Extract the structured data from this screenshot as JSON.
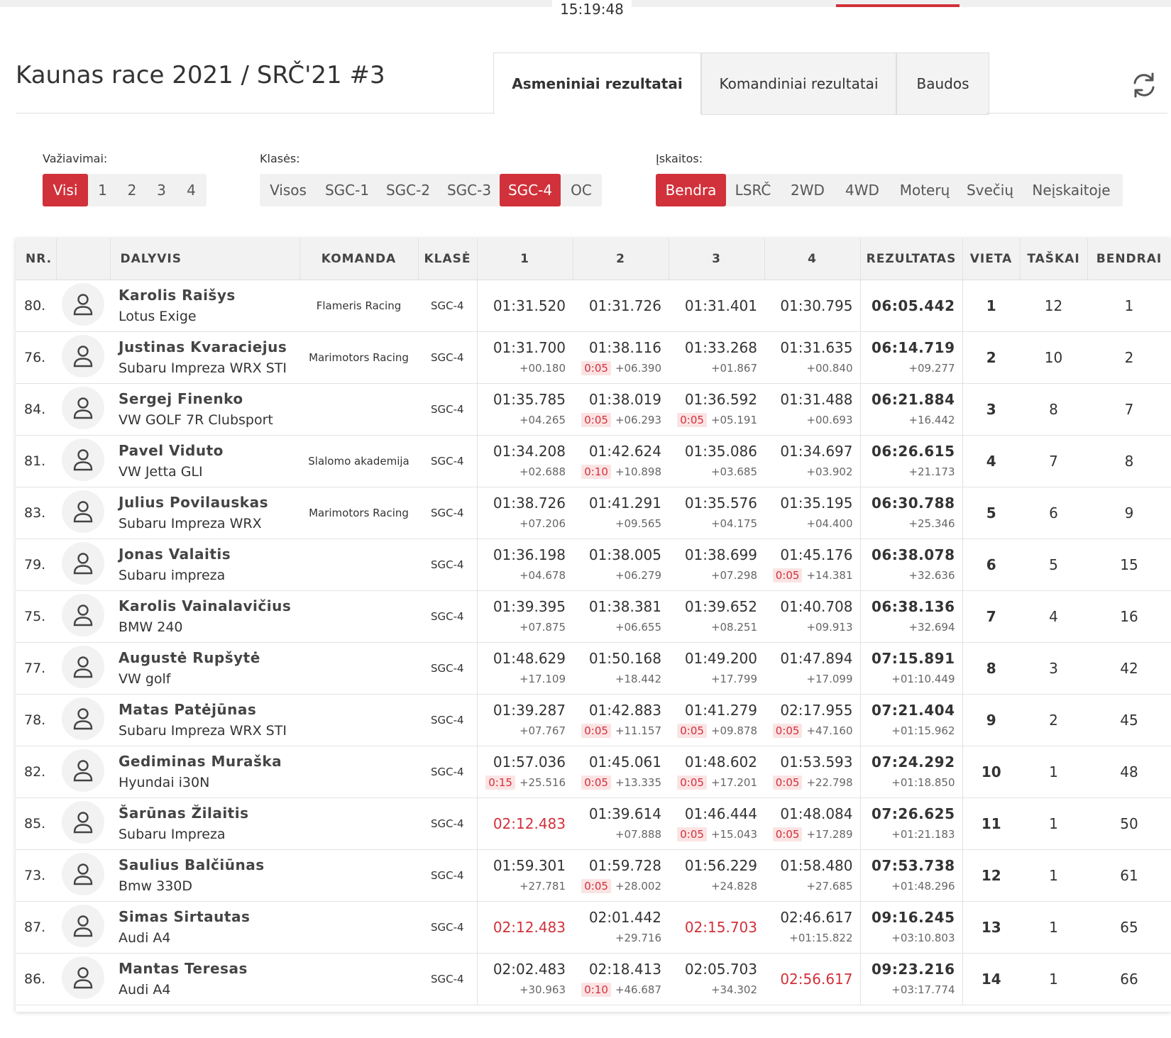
{
  "header": {
    "clock": "15:19:48",
    "title": "Kaunas race 2021 / SRČ'21 #3",
    "tabs": [
      {
        "label": "Asmeniniai rezultatai",
        "active": true
      },
      {
        "label": "Komandiniai rezultatai",
        "active": false
      },
      {
        "label": "Baudos",
        "active": false
      }
    ],
    "refresh_icon": "refresh-icon",
    "accent_color": "#d1313a"
  },
  "filters": {
    "runs": {
      "label": "Važiavimai:",
      "options": [
        "Visi",
        "1",
        "2",
        "3",
        "4"
      ],
      "active": "Visi"
    },
    "classes": {
      "label": "Klasės:",
      "options": [
        "Visos",
        "SGC-1",
        "SGC-2",
        "SGC-3",
        "SGC-4",
        "OC"
      ],
      "active": "SGC-4"
    },
    "standings": {
      "label": "Įskaitos:",
      "options": [
        "Bendra",
        "LSRČ",
        "2WD",
        "4WD",
        "Moterų",
        "Svečių",
        "Neįskaitoje"
      ],
      "active": "Bendra"
    }
  },
  "table": {
    "headers": {
      "nr": "NR.",
      "driver": "DALYVIS",
      "team": "KOMANDA",
      "klase": "KLASĖ",
      "r1": "1",
      "r2": "2",
      "r3": "3",
      "r4": "4",
      "result": "REZULTATAS",
      "vieta": "VIETA",
      "taskai": "TAŠKAI",
      "bendrai": "BENDRAI"
    },
    "rows": [
      {
        "nr": "80.",
        "name": "Karolis Raišys",
        "car": "Lotus Exige",
        "team": "Flameris Racing",
        "klase": "SGC-4",
        "runs": [
          {
            "t": "01:31.520",
            "d": "",
            "p": "",
            "red": false
          },
          {
            "t": "01:31.726",
            "d": "",
            "p": "",
            "red": false
          },
          {
            "t": "01:31.401",
            "d": "",
            "p": "",
            "red": false
          },
          {
            "t": "01:30.795",
            "d": "",
            "p": "",
            "red": false
          }
        ],
        "result": "06:05.442",
        "result_diff": "",
        "vieta": "1",
        "taskai": "12",
        "bendrai": "1"
      },
      {
        "nr": "76.",
        "name": "Justinas Kvaraciejus",
        "car": "Subaru Impreza WRX STI",
        "team": "Marimotors Racing",
        "klase": "SGC-4",
        "runs": [
          {
            "t": "01:31.700",
            "d": "+00.180",
            "p": "",
            "red": false
          },
          {
            "t": "01:38.116",
            "d": "+06.390",
            "p": "0:05",
            "red": false
          },
          {
            "t": "01:33.268",
            "d": "+01.867",
            "p": "",
            "red": false
          },
          {
            "t": "01:31.635",
            "d": "+00.840",
            "p": "",
            "red": false
          }
        ],
        "result": "06:14.719",
        "result_diff": "+09.277",
        "vieta": "2",
        "taskai": "10",
        "bendrai": "2"
      },
      {
        "nr": "84.",
        "name": "Sergej Finenko",
        "car": "VW GOLF 7R Clubsport",
        "team": "",
        "klase": "SGC-4",
        "runs": [
          {
            "t": "01:35.785",
            "d": "+04.265",
            "p": "",
            "red": false
          },
          {
            "t": "01:38.019",
            "d": "+06.293",
            "p": "0:05",
            "red": false
          },
          {
            "t": "01:36.592",
            "d": "+05.191",
            "p": "0:05",
            "red": false
          },
          {
            "t": "01:31.488",
            "d": "+00.693",
            "p": "",
            "red": false
          }
        ],
        "result": "06:21.884",
        "result_diff": "+16.442",
        "vieta": "3",
        "taskai": "8",
        "bendrai": "7"
      },
      {
        "nr": "81.",
        "name": "Pavel Viduto",
        "car": "VW Jetta GLI",
        "team": "Slalomo akademija",
        "klase": "SGC-4",
        "runs": [
          {
            "t": "01:34.208",
            "d": "+02.688",
            "p": "",
            "red": false
          },
          {
            "t": "01:42.624",
            "d": "+10.898",
            "p": "0:10",
            "red": false
          },
          {
            "t": "01:35.086",
            "d": "+03.685",
            "p": "",
            "red": false
          },
          {
            "t": "01:34.697",
            "d": "+03.902",
            "p": "",
            "red": false
          }
        ],
        "result": "06:26.615",
        "result_diff": "+21.173",
        "vieta": "4",
        "taskai": "7",
        "bendrai": "8"
      },
      {
        "nr": "83.",
        "name": "Julius Povilauskas",
        "car": "Subaru Impreza WRX",
        "team": "Marimotors Racing",
        "klase": "SGC-4",
        "runs": [
          {
            "t": "01:38.726",
            "d": "+07.206",
            "p": "",
            "red": false
          },
          {
            "t": "01:41.291",
            "d": "+09.565",
            "p": "",
            "red": false
          },
          {
            "t": "01:35.576",
            "d": "+04.175",
            "p": "",
            "red": false
          },
          {
            "t": "01:35.195",
            "d": "+04.400",
            "p": "",
            "red": false
          }
        ],
        "result": "06:30.788",
        "result_diff": "+25.346",
        "vieta": "5",
        "taskai": "6",
        "bendrai": "9"
      },
      {
        "nr": "79.",
        "name": "Jonas Valaitis",
        "car": "Subaru impreza",
        "team": "",
        "klase": "SGC-4",
        "runs": [
          {
            "t": "01:36.198",
            "d": "+04.678",
            "p": "",
            "red": false
          },
          {
            "t": "01:38.005",
            "d": "+06.279",
            "p": "",
            "red": false
          },
          {
            "t": "01:38.699",
            "d": "+07.298",
            "p": "",
            "red": false
          },
          {
            "t": "01:45.176",
            "d": "+14.381",
            "p": "0:05",
            "red": false
          }
        ],
        "result": "06:38.078",
        "result_diff": "+32.636",
        "vieta": "6",
        "taskai": "5",
        "bendrai": "15"
      },
      {
        "nr": "75.",
        "name": "Karolis Vainalavičius",
        "car": "BMW 240",
        "team": "",
        "klase": "SGC-4",
        "runs": [
          {
            "t": "01:39.395",
            "d": "+07.875",
            "p": "",
            "red": false
          },
          {
            "t": "01:38.381",
            "d": "+06.655",
            "p": "",
            "red": false
          },
          {
            "t": "01:39.652",
            "d": "+08.251",
            "p": "",
            "red": false
          },
          {
            "t": "01:40.708",
            "d": "+09.913",
            "p": "",
            "red": false
          }
        ],
        "result": "06:38.136",
        "result_diff": "+32.694",
        "vieta": "7",
        "taskai": "4",
        "bendrai": "16"
      },
      {
        "nr": "77.",
        "name": "Augustė Rupšytė",
        "car": "VW golf",
        "team": "",
        "klase": "SGC-4",
        "runs": [
          {
            "t": "01:48.629",
            "d": "+17.109",
            "p": "",
            "red": false
          },
          {
            "t": "01:50.168",
            "d": "+18.442",
            "p": "",
            "red": false
          },
          {
            "t": "01:49.200",
            "d": "+17.799",
            "p": "",
            "red": false
          },
          {
            "t": "01:47.894",
            "d": "+17.099",
            "p": "",
            "red": false
          }
        ],
        "result": "07:15.891",
        "result_diff": "+01:10.449",
        "vieta": "8",
        "taskai": "3",
        "bendrai": "42"
      },
      {
        "nr": "78.",
        "name": "Matas Patėjūnas",
        "car": "Subaru Impreza WRX STI",
        "team": "",
        "klase": "SGC-4",
        "runs": [
          {
            "t": "01:39.287",
            "d": "+07.767",
            "p": "",
            "red": false
          },
          {
            "t": "01:42.883",
            "d": "+11.157",
            "p": "0:05",
            "red": false
          },
          {
            "t": "01:41.279",
            "d": "+09.878",
            "p": "0:05",
            "red": false
          },
          {
            "t": "02:17.955",
            "d": "+47.160",
            "p": "0:05",
            "red": false
          }
        ],
        "result": "07:21.404",
        "result_diff": "+01:15.962",
        "vieta": "9",
        "taskai": "2",
        "bendrai": "45"
      },
      {
        "nr": "82.",
        "name": "Gediminas Muraška",
        "car": "Hyundai i30N",
        "team": "",
        "klase": "SGC-4",
        "runs": [
          {
            "t": "01:57.036",
            "d": "+25.516",
            "p": "0:15",
            "red": false
          },
          {
            "t": "01:45.061",
            "d": "+13.335",
            "p": "0:05",
            "red": false
          },
          {
            "t": "01:48.602",
            "d": "+17.201",
            "p": "0:05",
            "red": false
          },
          {
            "t": "01:53.593",
            "d": "+22.798",
            "p": "0:05",
            "red": false
          }
        ],
        "result": "07:24.292",
        "result_diff": "+01:18.850",
        "vieta": "10",
        "taskai": "1",
        "bendrai": "48"
      },
      {
        "nr": "85.",
        "name": "Šarūnas Žilaitis",
        "car": "Subaru Impreza",
        "team": "",
        "klase": "SGC-4",
        "runs": [
          {
            "t": "02:12.483",
            "d": "",
            "p": "",
            "red": true
          },
          {
            "t": "01:39.614",
            "d": "+07.888",
            "p": "",
            "red": false
          },
          {
            "t": "01:46.444",
            "d": "+15.043",
            "p": "0:05",
            "red": false
          },
          {
            "t": "01:48.084",
            "d": "+17.289",
            "p": "0:05",
            "red": false
          }
        ],
        "result": "07:26.625",
        "result_diff": "+01:21.183",
        "vieta": "11",
        "taskai": "1",
        "bendrai": "50"
      },
      {
        "nr": "73.",
        "name": "Saulius Balčiūnas",
        "car": "Bmw 330D",
        "team": "",
        "klase": "SGC-4",
        "runs": [
          {
            "t": "01:59.301",
            "d": "+27.781",
            "p": "",
            "red": false
          },
          {
            "t": "01:59.728",
            "d": "+28.002",
            "p": "0:05",
            "red": false
          },
          {
            "t": "01:56.229",
            "d": "+24.828",
            "p": "",
            "red": false
          },
          {
            "t": "01:58.480",
            "d": "+27.685",
            "p": "",
            "red": false
          }
        ],
        "result": "07:53.738",
        "result_diff": "+01:48.296",
        "vieta": "12",
        "taskai": "1",
        "bendrai": "61"
      },
      {
        "nr": "87.",
        "name": "Simas Sirtautas",
        "car": "Audi A4",
        "team": "",
        "klase": "SGC-4",
        "runs": [
          {
            "t": "02:12.483",
            "d": "",
            "p": "",
            "red": true
          },
          {
            "t": "02:01.442",
            "d": "+29.716",
            "p": "",
            "red": false
          },
          {
            "t": "02:15.703",
            "d": "",
            "p": "",
            "red": true
          },
          {
            "t": "02:46.617",
            "d": "+01:15.822",
            "p": "",
            "red": false
          }
        ],
        "result": "09:16.245",
        "result_diff": "+03:10.803",
        "vieta": "13",
        "taskai": "1",
        "bendrai": "65"
      },
      {
        "nr": "86.",
        "name": "Mantas Teresas",
        "car": "Audi A4",
        "team": "",
        "klase": "SGC-4",
        "runs": [
          {
            "t": "02:02.483",
            "d": "+30.963",
            "p": "",
            "red": false
          },
          {
            "t": "02:18.413",
            "d": "+46.687",
            "p": "0:10",
            "red": false
          },
          {
            "t": "02:05.703",
            "d": "+34.302",
            "p": "",
            "red": false
          },
          {
            "t": "02:56.617",
            "d": "",
            "p": "",
            "red": true
          }
        ],
        "result": "09:23.216",
        "result_diff": "+03:17.774",
        "vieta": "14",
        "taskai": "1",
        "bendrai": "66"
      }
    ]
  }
}
